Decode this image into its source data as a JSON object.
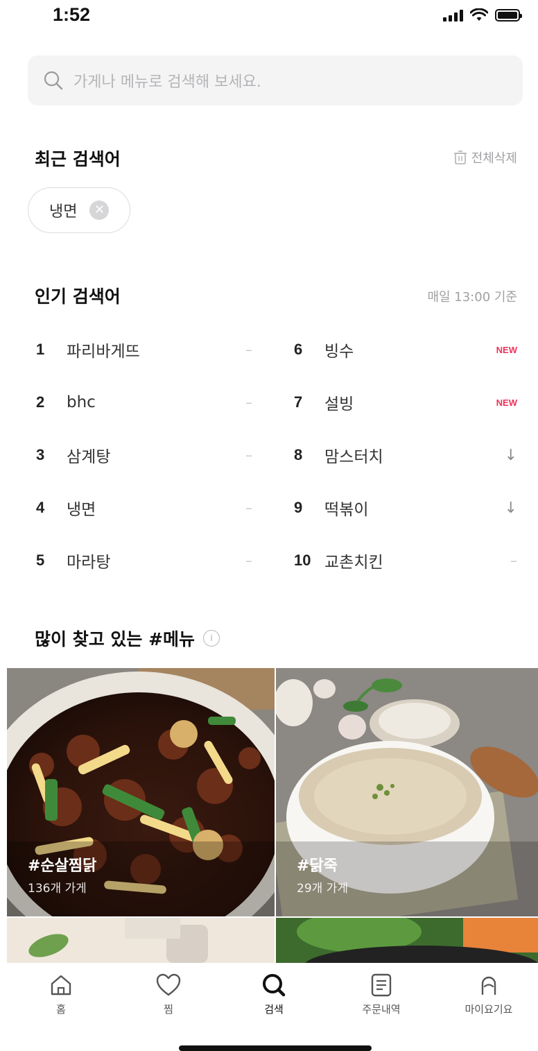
{
  "status_bar": {
    "time": "1:52"
  },
  "search": {
    "placeholder": "가게나 메뉴로 검색해 보세요."
  },
  "recent": {
    "title": "최근 검색어",
    "clear_all": "전체삭제",
    "chips": [
      "냉면"
    ]
  },
  "popular": {
    "title": "인기 검색어",
    "basis": "매일 13:00 기준",
    "items": [
      {
        "rank": "1",
        "keyword": "파리바게뜨",
        "trend": "–"
      },
      {
        "rank": "2",
        "keyword": "bhc",
        "trend": "–"
      },
      {
        "rank": "3",
        "keyword": "삼계탕",
        "trend": "–"
      },
      {
        "rank": "4",
        "keyword": "냉면",
        "trend": "–"
      },
      {
        "rank": "5",
        "keyword": "마라탕",
        "trend": "–"
      },
      {
        "rank": "6",
        "keyword": "빙수",
        "trend": "NEW"
      },
      {
        "rank": "7",
        "keyword": "설빙",
        "trend": "NEW"
      },
      {
        "rank": "8",
        "keyword": "맘스터치",
        "trend": "↓"
      },
      {
        "rank": "9",
        "keyword": "떡볶이",
        "trend": "↓"
      },
      {
        "rank": "10",
        "keyword": "교촌치킨",
        "trend": "–"
      }
    ]
  },
  "menus": {
    "title": "많이 찾고 있는 #메뉴",
    "tiles": [
      {
        "tag": "#순살찜닭",
        "count": "136개 가게"
      },
      {
        "tag": "#닭죽",
        "count": "29개 가게"
      }
    ]
  },
  "nav": {
    "items": [
      {
        "label": "홈",
        "icon": "home-icon"
      },
      {
        "label": "찜",
        "icon": "heart-icon"
      },
      {
        "label": "검색",
        "icon": "search-icon"
      },
      {
        "label": "주문내역",
        "icon": "receipt-icon"
      },
      {
        "label": "마이요기요",
        "icon": "profile-icon"
      }
    ],
    "active": "검색"
  },
  "colors": {
    "accent_new": "#f0315a",
    "search_bg": "#f4f4f5",
    "text_muted": "#a0a0a3"
  }
}
